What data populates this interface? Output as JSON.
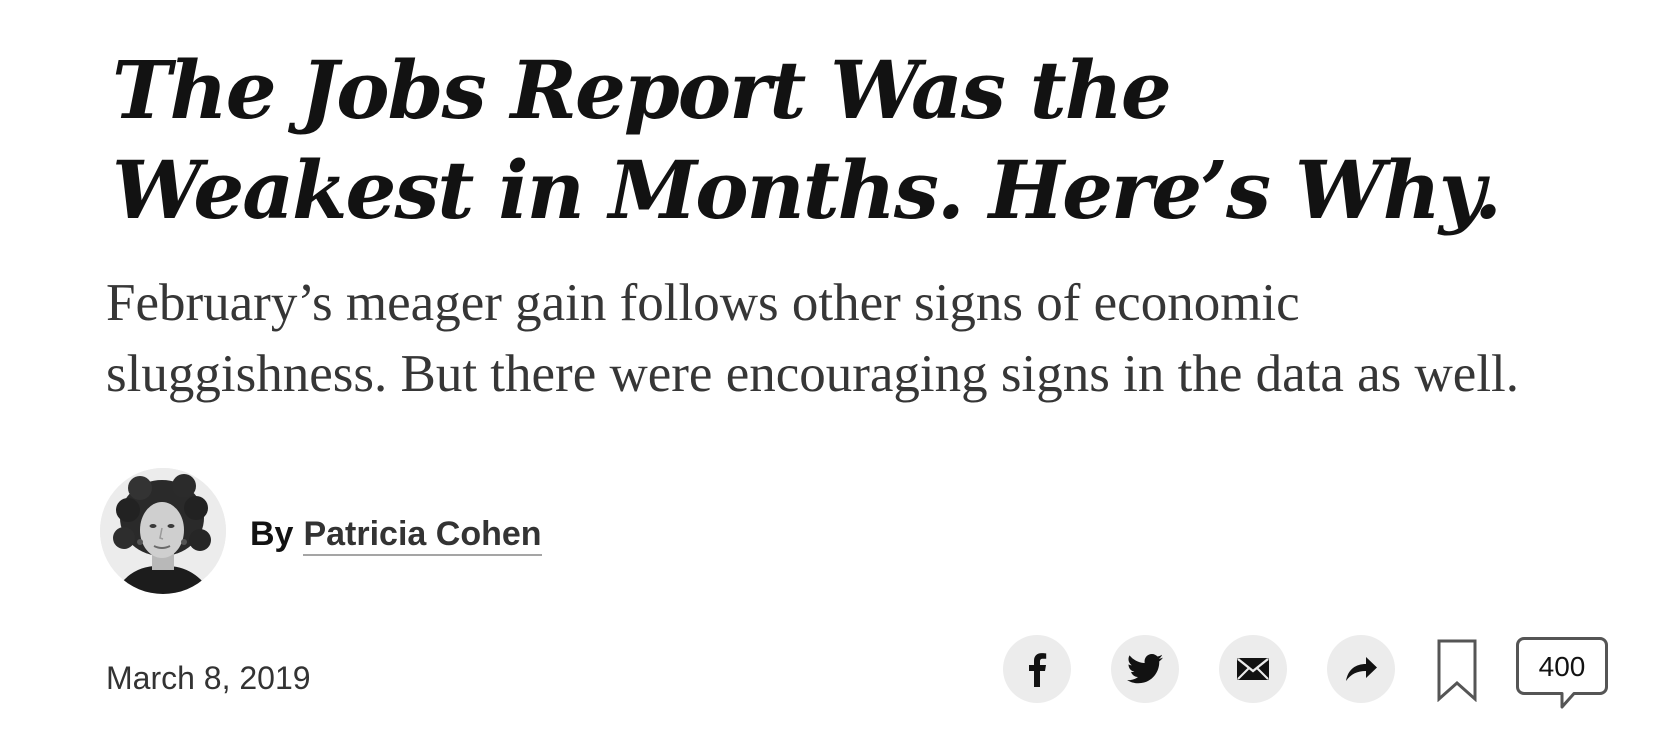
{
  "article": {
    "headline_lines": [
      "The Jobs Report Was the",
      "Weakest in Months. Here’s Why."
    ],
    "summary_lines": [
      "February’s meager gain follows other signs of economic",
      "sluggishness. But there were encouraging signs in the data as well."
    ],
    "byline": {
      "prefix": "By",
      "author": "Patricia Cohen"
    },
    "date": "March 8, 2019"
  },
  "share_tools": {
    "items": [
      {
        "icon": "facebook-icon"
      },
      {
        "icon": "twitter-icon"
      },
      {
        "icon": "email-icon"
      },
      {
        "icon": "share-arrow-icon"
      }
    ],
    "bookmark_icon": "bookmark-icon",
    "comment_icon": "comment-bubble-icon",
    "comments_count": "400"
  },
  "colors": {
    "text": "#121212",
    "summary_text": "#363636",
    "button_bg": "#ececec",
    "icon": "#121212",
    "outline": "#555555"
  }
}
